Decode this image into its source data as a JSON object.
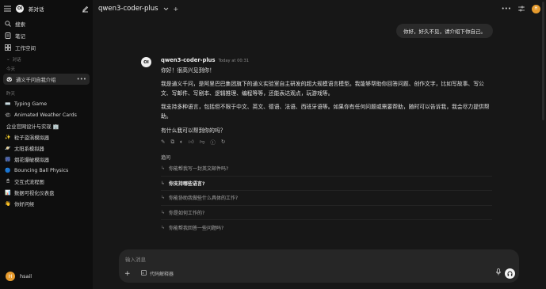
{
  "sidebar": {
    "title": "新对话",
    "nav": [
      {
        "label": "搜索",
        "icon": "search-icon"
      },
      {
        "label": "笔记",
        "icon": "notes-icon"
      },
      {
        "label": "工作空间",
        "icon": "workspace-icon"
      }
    ],
    "section_chats": "对话",
    "section_today": "今天",
    "today_items": [
      {
        "emoji": "🐼",
        "label": "通义千问自我介绍"
      }
    ],
    "section_yesterday": "昨天",
    "yesterday_items": [
      {
        "emoji": "⌨️",
        "label": "Typing Game"
      },
      {
        "emoji": "🌤",
        "label": "Animated Weather Cards"
      },
      {
        "emoji": "",
        "label": "企业官网设计与实现 🏢"
      },
      {
        "emoji": "✨",
        "label": "粒子漩涡模拟器"
      },
      {
        "emoji": "🪐",
        "label": "太阳系模拟器"
      },
      {
        "emoji": "🎆",
        "label": "烟花爆破模拟器"
      },
      {
        "emoji": "🔵",
        "label": "Bouncing Ball Physics"
      },
      {
        "emoji": "🖱",
        "label": "交互式流程图"
      },
      {
        "emoji": "📊",
        "label": "数据可视化仪表盘"
      },
      {
        "emoji": "👋",
        "label": "你好问候"
      }
    ],
    "user": {
      "initial": "H",
      "name": "hsail"
    }
  },
  "header": {
    "model": "qwen3-coder-plus",
    "avatar_initial": "H"
  },
  "conversation": {
    "user_message": "你好，好久不见，请介绍下你自己。",
    "assistant": {
      "logo": "OI",
      "model": "qwen3-coder-plus",
      "time": "Today at 00:31",
      "p1": "你好！很高兴见到你！",
      "p2": "我是通义千问，是阿里巴巴集团旗下的通义实验室自主研发的超大规模语言模型。我能够帮助你回答问题、创作文字，比如写故事、写公文、写邮件、写剧本、逻辑推理、编程等等，还能表达观点，玩游戏等。",
      "p3": "我支持多种语言，包括但不限于中文、英文、德语、法语、西班牙语等。如果你有任何问题或需要帮助，随时可以告诉我，我会尽力提供帮助。",
      "p4": "有什么我可以帮到你的吗？"
    },
    "followup_title": "追问",
    "followups": [
      "你能帮我写一封英文邮件吗?",
      "你支持哪些语言?",
      "你能协助我做些什么具体的工作?",
      "你是如何工作的?",
      "你能帮我回答一些问题吗?"
    ]
  },
  "input": {
    "placeholder": "输入消息",
    "tool_label": "代码解释器"
  }
}
